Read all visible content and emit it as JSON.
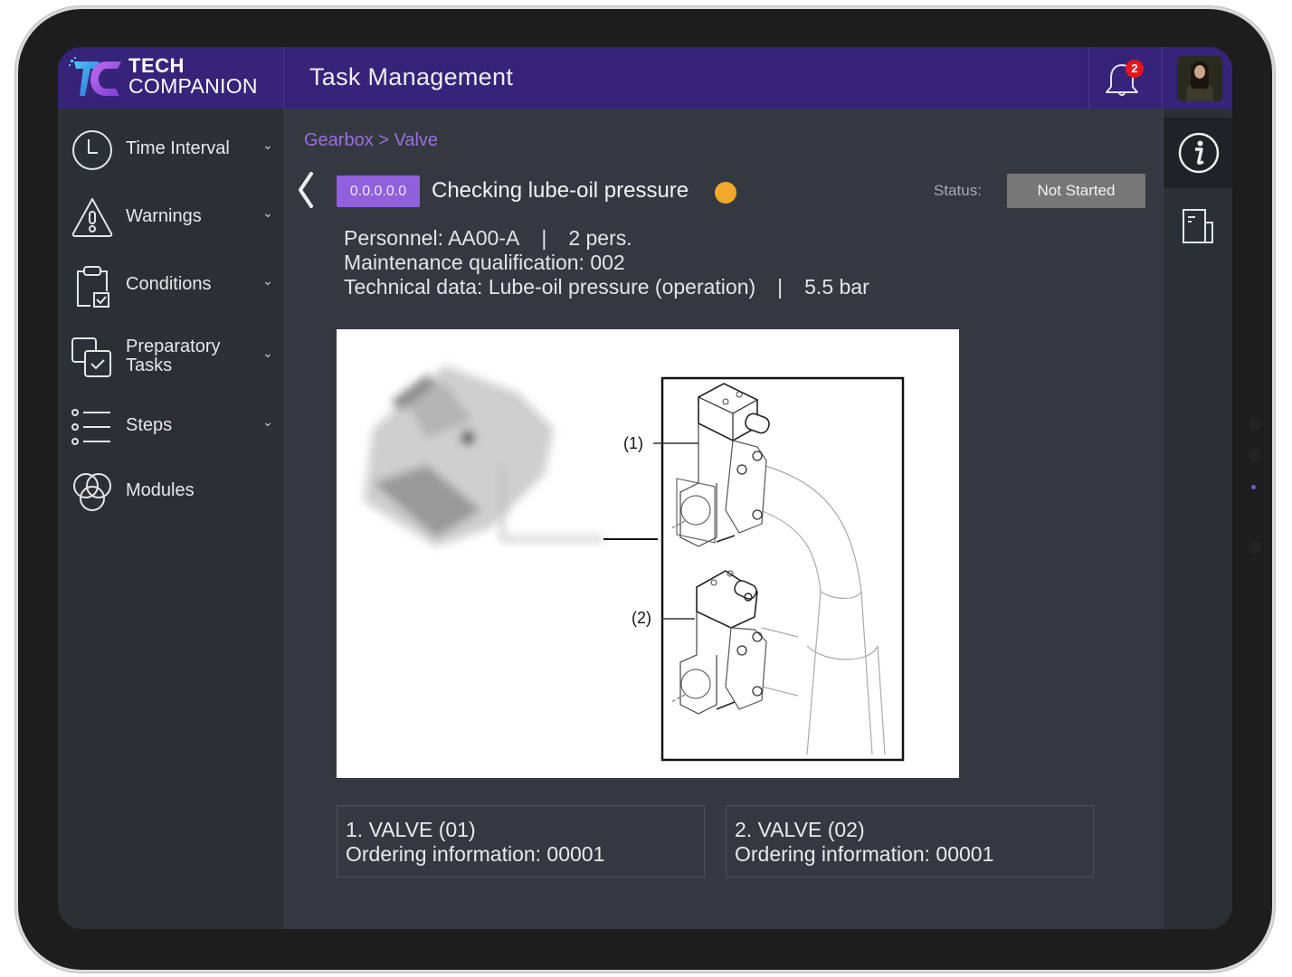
{
  "app": {
    "logo_line1": "TECH",
    "logo_line2": "COMPANION",
    "page_title": "Task Management",
    "notifications_count": "2",
    "brand_color": "#36237a",
    "accent_color": "#9160dc"
  },
  "sidebar": {
    "items": [
      {
        "label": "Time Interval",
        "icon": "clock-icon",
        "expandable": true
      },
      {
        "label": "Warnings",
        "icon": "warning-icon",
        "expandable": true
      },
      {
        "label": "Conditions",
        "icon": "clipboard-check-icon",
        "expandable": true
      },
      {
        "label_line1": "Preparatory",
        "label_line2": "Tasks",
        "icon": "checkbox-stack-icon",
        "expandable": true
      },
      {
        "label": "Steps",
        "icon": "list-icon",
        "expandable": true
      },
      {
        "label": "Modules",
        "icon": "circles-icon",
        "expandable": false
      }
    ],
    "chevron": "⌄"
  },
  "rail": {
    "items": [
      {
        "icon": "info-icon",
        "active": true
      },
      {
        "icon": "document-icon",
        "active": false
      }
    ]
  },
  "main": {
    "breadcrumb": "Gearbox > Valve",
    "task_code": "0.0.0.0.0",
    "task_title": "Checking lube-oil pressure",
    "status_dot_color": "#f0a92a",
    "status_label": "Status:",
    "status_value": "Not Started",
    "personnel_label": "Personnel: AA00-A",
    "personnel_count": "2 pers.",
    "qualification": "Maintenance qualification: 002",
    "technical_data": "Technical data: Lube-oil pressure (operation)",
    "technical_value": "5.5 bar",
    "separator": "|",
    "figure": {
      "callout_1": "(1)",
      "callout_2": "(2)"
    },
    "parts": [
      {
        "name": "1. VALVE (01)",
        "ordering": "Ordering information: 00001"
      },
      {
        "name": "2. VALVE (02)",
        "ordering": "Ordering information: 00001"
      }
    ]
  }
}
